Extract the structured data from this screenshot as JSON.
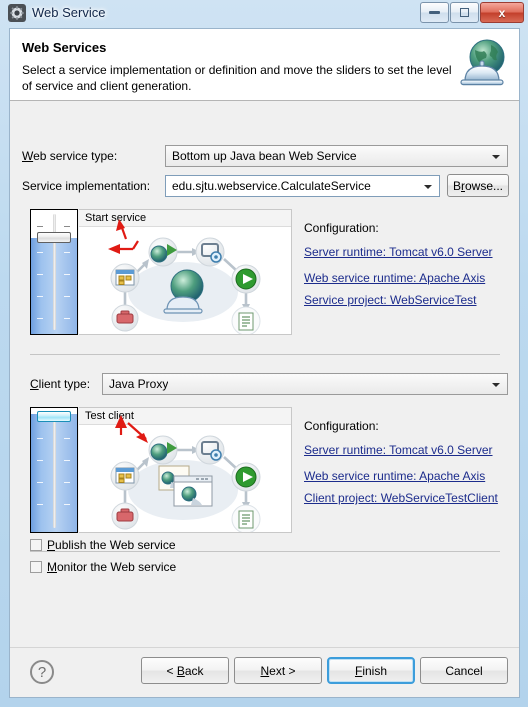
{
  "window": {
    "title": "Web Service",
    "icon": "gear-icon",
    "controls": {
      "minimize": "minimize-icon",
      "restore": "restore-icon",
      "close": "x"
    }
  },
  "header": {
    "title": "Web Services",
    "description": "Select a service implementation or definition and move the sliders to set the level of service and client generation.",
    "icon": "globe-service-icon"
  },
  "fields": {
    "web_service_type": {
      "label": "Web service type:",
      "mnemonic": "W",
      "value": "Bottom up Java bean Web Service"
    },
    "service_implementation": {
      "label": "Service implementation:",
      "value": "edu.sjtu.webservice.CalculateService",
      "browse_label": "Browse...",
      "browse_mnemonic": "r"
    },
    "client_type": {
      "label": "Client type:",
      "mnemonic": "C",
      "value": "Java Proxy"
    }
  },
  "service_panel": {
    "slider_label": "Start service",
    "config_title": "Configuration:",
    "links": [
      "Server runtime: Tomcat v6.0 Server",
      "Web service runtime: Apache Axis",
      "Service project: WebServiceTest"
    ],
    "annotation_color": "#e01b14"
  },
  "client_panel": {
    "slider_label": "Test client",
    "config_title": "Configuration:",
    "links": [
      "Server runtime: Tomcat v6.0 Server",
      "Web service runtime: Apache Axis",
      "Client project: WebServiceTestClient"
    ],
    "annotation_color": "#e01b14"
  },
  "checkboxes": [
    {
      "label": "Publish the Web service",
      "mnemonic": "P",
      "checked": false
    },
    {
      "label": "Monitor the Web service",
      "mnemonic": "M",
      "checked": false
    }
  ],
  "buttons": {
    "help": "?",
    "back": "< Back",
    "back_mnemonic": "B",
    "next": "Next >",
    "next_mnemonic": "N",
    "finish": "Finish",
    "finish_mnemonic": "F",
    "cancel": "Cancel",
    "focused": "Finish"
  },
  "colors": {
    "link": "#1c2c8c",
    "focus_ring": "#3c9ddb",
    "slider_fill": "#9dc2ee",
    "annotation": "#e01b14",
    "titlebar_text": "#13284a"
  }
}
